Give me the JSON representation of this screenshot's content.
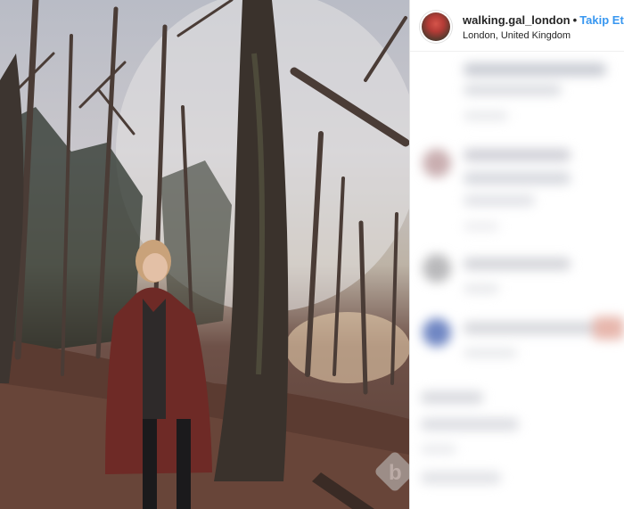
{
  "post": {
    "username": "walking.gal_london",
    "separator": "•",
    "follow_label": "Takip Et",
    "location": "London, United Kingdom"
  },
  "photo": {
    "subject": "woman in maroon coat standing in bare winter forest",
    "watermark": "b"
  },
  "comments": {
    "state": "blurred"
  },
  "colors": {
    "follow": "#3897f0",
    "text": "#262626",
    "coat": "#6e2a26"
  }
}
